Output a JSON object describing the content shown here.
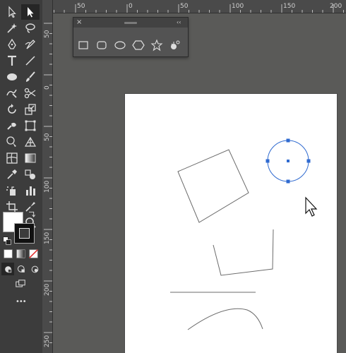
{
  "rulers": {
    "horizontal": [
      "50",
      "0",
      "50",
      "100",
      "150",
      "200"
    ],
    "vertical": [
      "50",
      "0",
      "50",
      "100",
      "150",
      "200",
      "250"
    ]
  },
  "toolbar": {
    "tools": [
      "selection-tool",
      "direct-selection-tool",
      "magic-wand-tool",
      "lasso-tool",
      "pen-tool",
      "curvature-tool",
      "type-tool",
      "line-segment-tool",
      "ellipse-tool",
      "paintbrush-tool",
      "shaper-tool",
      "scissors-tool",
      "rotate-tool",
      "scale-tool",
      "warp-tool",
      "free-transform-tool",
      "shape-builder-tool",
      "perspective-grid-tool",
      "mesh-tool",
      "gradient-tool",
      "eyedropper-tool",
      "blend-tool",
      "symbol-sprayer-tool",
      "column-graph-tool",
      "artboard-tool",
      "slice-tool",
      "hand-tool",
      "zoom-tool"
    ],
    "more_label": "•••"
  },
  "shapes_panel": {
    "close_glyph": "×",
    "collapse_glyph": "‹‹",
    "tools": [
      "rectangle",
      "rounded-rectangle",
      "ellipse",
      "polygon",
      "star",
      "flare"
    ]
  },
  "colors": {
    "interface_bg": "#5a5a58",
    "toolbar_bg": "#3c3c3c",
    "selection_blue": "#2f6ad0",
    "artboard": "#ffffff"
  }
}
